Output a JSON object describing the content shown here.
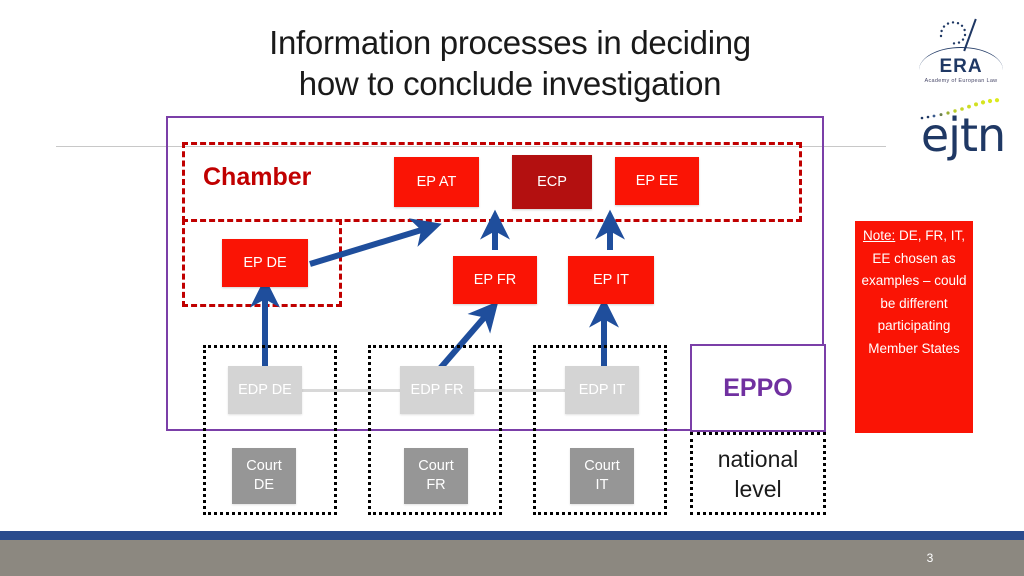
{
  "slide": {
    "title_line1": "Information processes in deciding",
    "title_line2": "how to conclude investigation",
    "page_number": "3"
  },
  "logos": {
    "era": {
      "name": "ERA",
      "subtitle": "Academy of European Law"
    },
    "ejtn": {
      "name": "ejtn"
    }
  },
  "diagram": {
    "outer_label": "EPPO",
    "chamber_label": "Chamber",
    "national_level_label": "national level",
    "eppo_boxes": [
      {
        "id": "ep-at",
        "label": "EP AT"
      },
      {
        "id": "ecp",
        "label": "ECP"
      },
      {
        "id": "ep-ee",
        "label": "EP EE"
      },
      {
        "id": "ep-de",
        "label": "EP DE"
      },
      {
        "id": "ep-fr",
        "label": "EP FR"
      },
      {
        "id": "ep-it",
        "label": "EP IT"
      }
    ],
    "edp_boxes": [
      {
        "id": "edp-de",
        "label": "EDP DE"
      },
      {
        "id": "edp-fr",
        "label": "EDP FR"
      },
      {
        "id": "edp-it",
        "label": "EDP IT"
      }
    ],
    "court_boxes": [
      {
        "id": "court-de",
        "line1": "Court",
        "line2": "DE"
      },
      {
        "id": "court-fr",
        "line1": "Court",
        "line2": "FR"
      },
      {
        "id": "court-it",
        "line1": "Court",
        "line2": "IT"
      }
    ]
  },
  "note": {
    "heading": "Note:",
    "body": "DE, FR, IT, EE chosen as examples – could be different participating Member States"
  },
  "colors": {
    "red": "#FA1405",
    "dark_red": "#B31010",
    "chamber_red": "#C00000",
    "purple": "#7030A0",
    "purple_border": "#7B3FA8",
    "arrow_blue": "#1F4E9C",
    "grey_light": "#D4D4D4",
    "grey_mid": "#969696",
    "footer_blue": "#2A4B8D",
    "footer_grey": "#8C8880"
  }
}
